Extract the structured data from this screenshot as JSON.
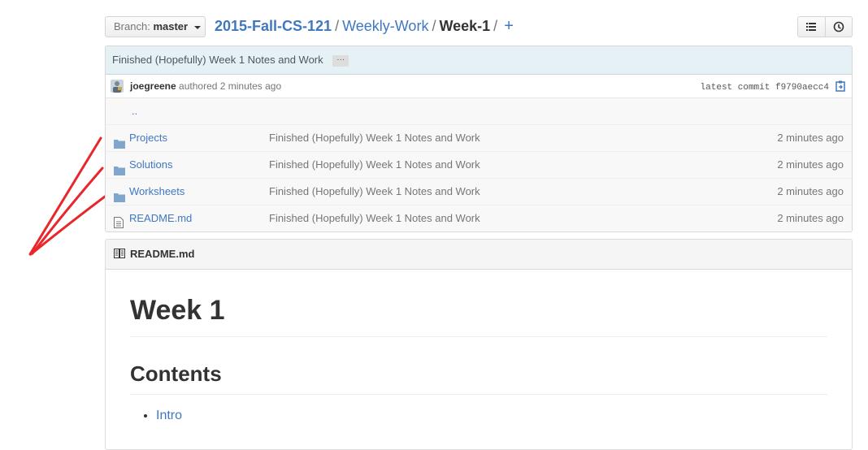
{
  "branch": {
    "prefix": "Branch:",
    "name": "master"
  },
  "breadcrumb": {
    "repo": "2015-Fall-CS-121",
    "sep1": "/",
    "folder": "Weekly-Work",
    "sep2": "/",
    "current": "Week-1",
    "sep3": "/",
    "add": "+"
  },
  "view_buttons": [
    "list-icon",
    "history-icon"
  ],
  "commit": {
    "message": "Finished (Hopefully) Week 1 Notes and Work",
    "expand_label": "···",
    "author": "joegreene",
    "action": "authored",
    "time": "2 minutes ago",
    "latest_label": "latest commit",
    "sha": "f9790aecc4"
  },
  "up_link": "..",
  "files": [
    {
      "type": "folder",
      "name": "Projects",
      "message": "Finished (Hopefully) Week 1 Notes and Work",
      "age": "2 minutes ago"
    },
    {
      "type": "folder",
      "name": "Solutions",
      "message": "Finished (Hopefully) Week 1 Notes and Work",
      "age": "2 minutes ago"
    },
    {
      "type": "folder",
      "name": "Worksheets",
      "message": "Finished (Hopefully) Week 1 Notes and Work",
      "age": "2 minutes ago"
    },
    {
      "type": "file",
      "name": "README.md",
      "message": "Finished (Hopefully) Week 1 Notes and Work",
      "age": "2 minutes ago"
    }
  ],
  "readme": {
    "filename": "README.md",
    "h1": "Week 1",
    "h2": "Contents",
    "items": [
      "Intro"
    ]
  },
  "colors": {
    "link": "#4078c0",
    "annotation": "#e8262b",
    "folder": "#80a6cd"
  }
}
